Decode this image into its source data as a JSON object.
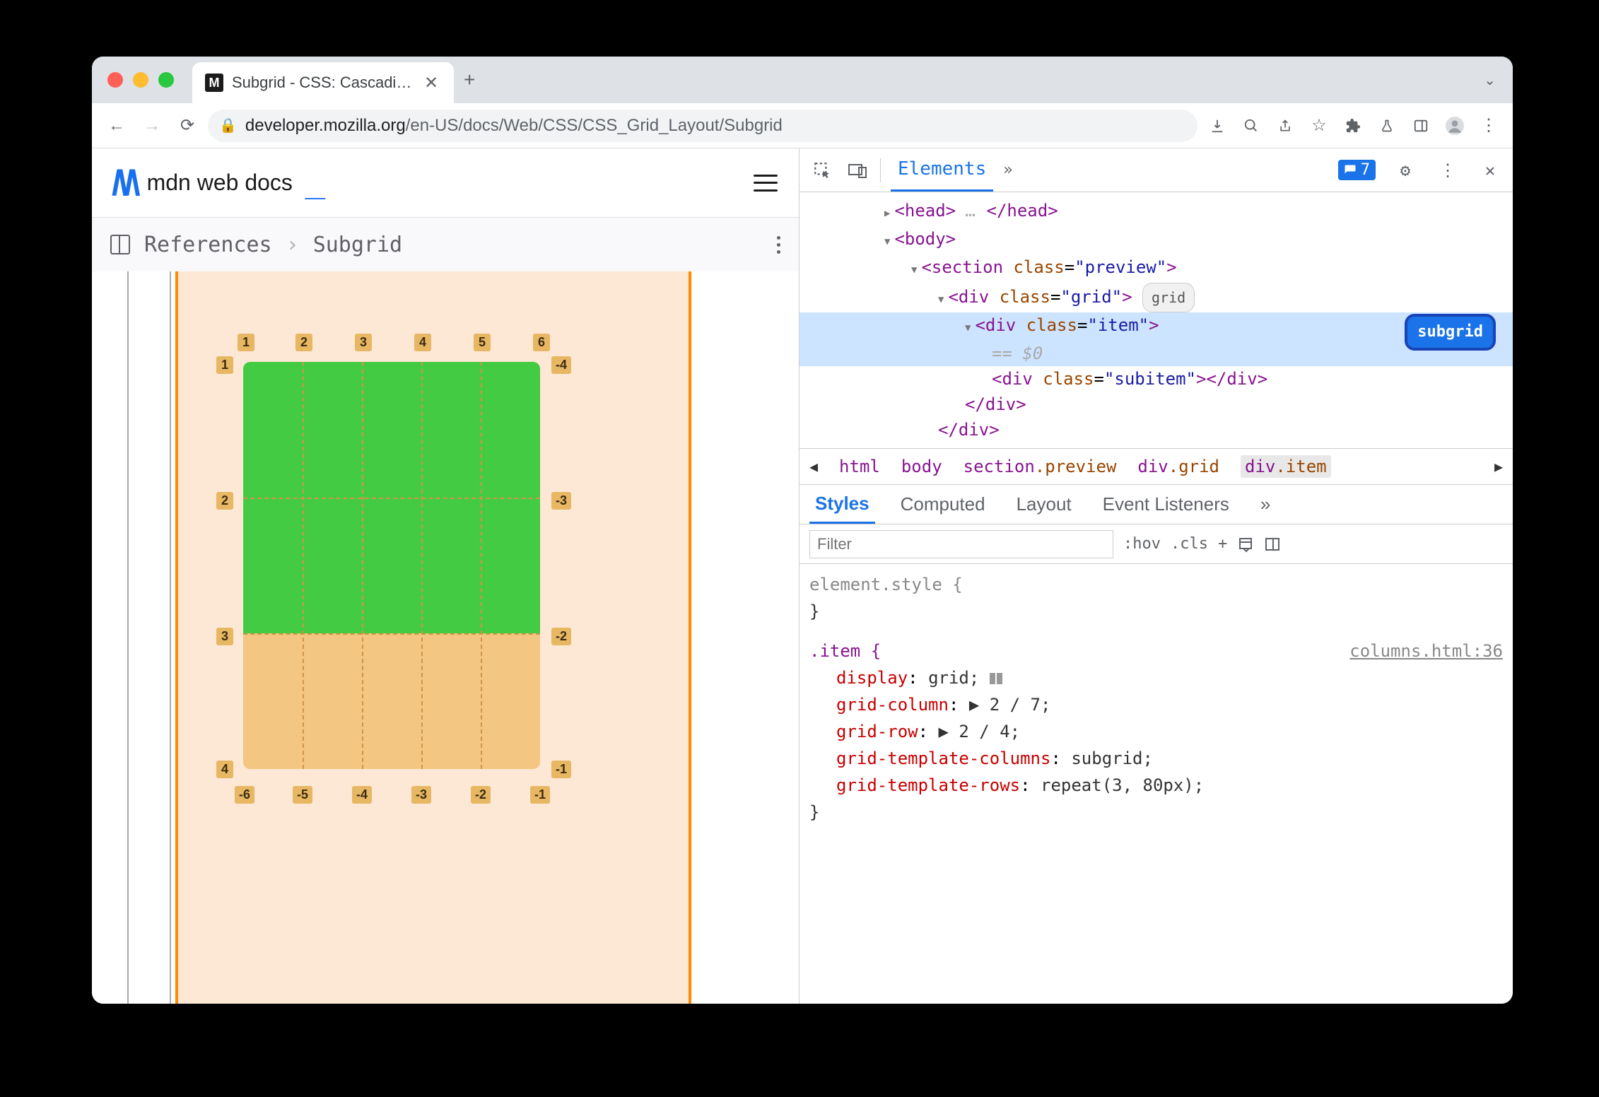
{
  "browser": {
    "tab_title": "Subgrid - CSS: Cascading Styl…",
    "url_host": "developer.mozilla.org",
    "url_path": "/en-US/docs/Web/CSS/CSS_Grid_Layout/Subgrid"
  },
  "mdn": {
    "logo_text": "mdn web docs",
    "breadcrumb": {
      "refs": "References",
      "current": "Subgrid"
    }
  },
  "grid_labels": {
    "top": [
      "1",
      "2",
      "3",
      "4",
      "5",
      "6"
    ],
    "left": [
      "1",
      "2",
      "3",
      "4"
    ],
    "right": [
      "-4",
      "-3",
      "-2",
      "-1"
    ],
    "bottom": [
      "-6",
      "-5",
      "-4",
      "-3",
      "-2",
      "-1"
    ]
  },
  "devtools": {
    "tabs": {
      "elements": "Elements"
    },
    "issue_count": "7",
    "dom": {
      "head": "<head>",
      "head_close": "</head>",
      "body": "<body>",
      "section": "<section class=\"preview\">",
      "grid": "<div class=\"grid\">",
      "grid_pill": "grid",
      "item": "<div class=\"item\">",
      "item_pill": "subgrid",
      "eq": "== $0",
      "subitem": "<div class=\"subitem\"></div>",
      "item_close": "</div>",
      "grid_close": "</div>",
      "dots": "…"
    },
    "crumbs": [
      "html",
      "body",
      "section.preview",
      "div.grid",
      "div.item"
    ],
    "style_tabs": [
      "Styles",
      "Computed",
      "Layout",
      "Event Listeners"
    ],
    "filter_placeholder": "Filter",
    "filter_buttons": [
      ":hov",
      ".cls"
    ],
    "styles": {
      "element_style": "element.style {",
      "element_close": "}",
      "item_sel": ".item {",
      "item_src": "columns.html:36",
      "rules": [
        {
          "p": "display",
          "v": "grid;"
        },
        {
          "p": "grid-column",
          "v": "▶ 2 / 7;"
        },
        {
          "p": "grid-row",
          "v": "▶ 2 / 4;"
        },
        {
          "p": "grid-template-columns",
          "v": "subgrid;"
        },
        {
          "p": "grid-template-rows",
          "v": "repeat(3, 80px);"
        }
      ],
      "item_close": "}"
    }
  }
}
